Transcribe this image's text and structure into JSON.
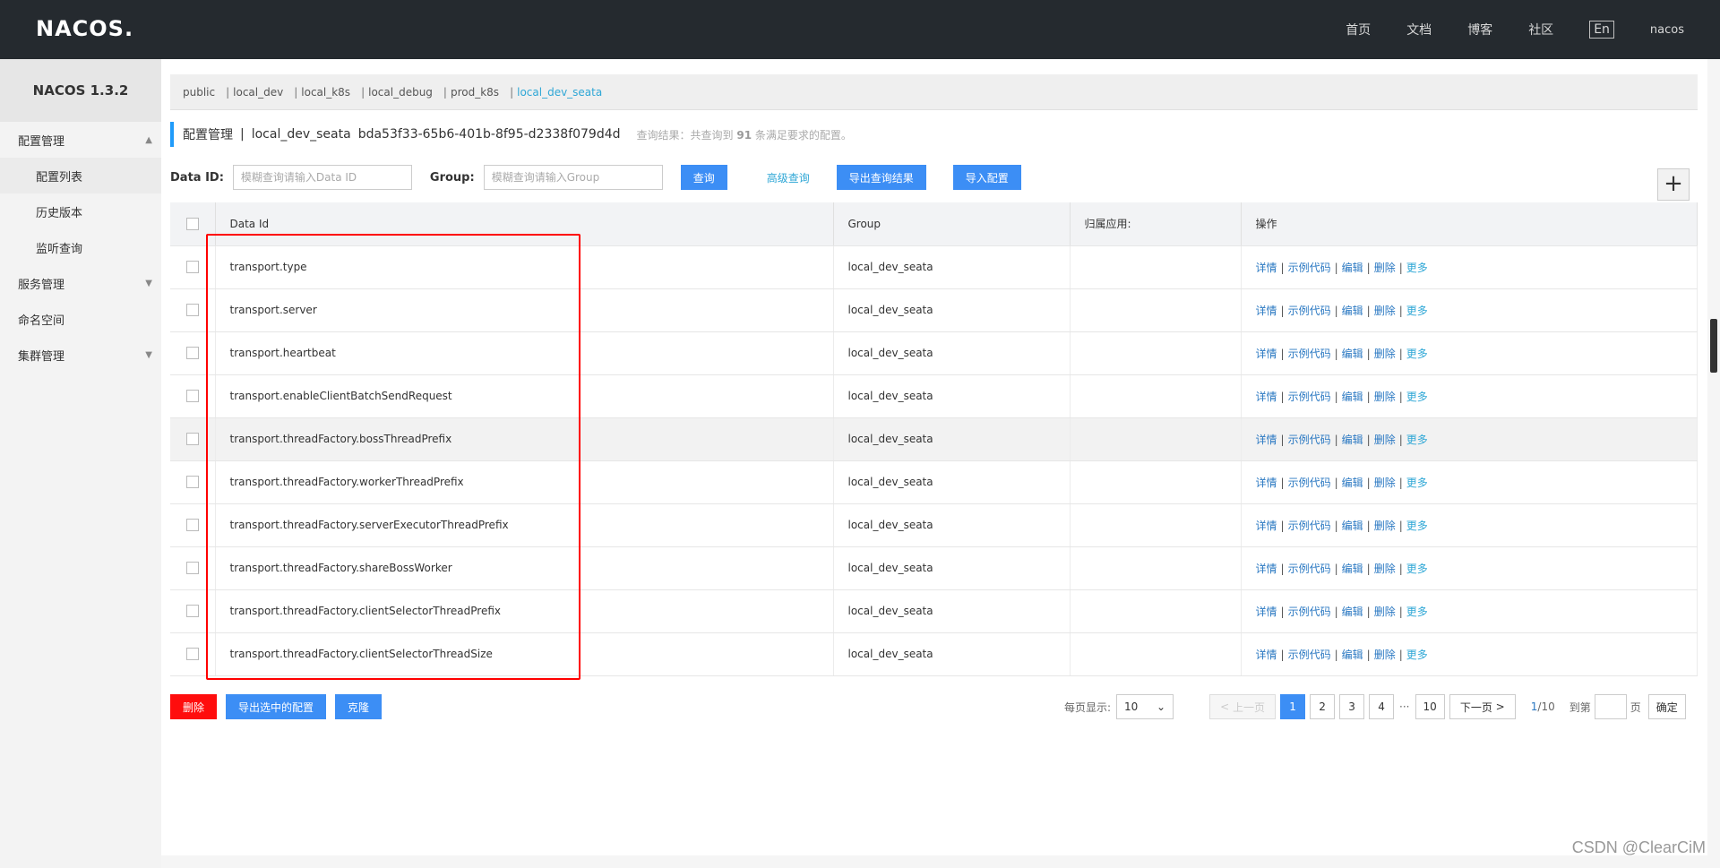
{
  "app": {
    "logo": "NACOS.",
    "nav": [
      "首页",
      "文档",
      "博客",
      "社区"
    ],
    "lang": "En",
    "user": "nacos"
  },
  "sidebar": {
    "brand": "NACOS 1.3.2",
    "groups": [
      {
        "label": "配置管理",
        "expanded": true,
        "items": [
          "配置列表",
          "历史版本",
          "监听查询"
        ]
      },
      {
        "label": "服务管理",
        "expanded": false
      },
      {
        "label": "命名空间"
      },
      {
        "label": "集群管理",
        "expanded": false
      }
    ]
  },
  "namespaces": [
    "public",
    "local_dev",
    "local_k8s",
    "local_debug",
    "prod_k8s",
    "local_dev_seata"
  ],
  "active_namespace": "local_dev_seata",
  "header": {
    "title": "配置管理",
    "namespace": "local_dev_seata",
    "namespace_id": "bda53f33-65b6-401b-8f95-d2338f079d4d",
    "result_prefix": "查询结果：共查询到",
    "result_count": "91",
    "result_suffix": "条满足要求的配置。"
  },
  "search": {
    "dataid_label": "Data ID:",
    "dataid_placeholder": "模糊查询请输入Data ID",
    "group_label": "Group:",
    "group_placeholder": "模糊查询请输入Group",
    "query": "查询",
    "advanced": "高级查询",
    "export_results": "导出查询结果",
    "import": "导入配置"
  },
  "table": {
    "headers": [
      "Data Id",
      "Group",
      "归属应用:",
      "操作"
    ],
    "rows": [
      {
        "data_id": "transport.type",
        "group": "local_dev_seata",
        "app": ""
      },
      {
        "data_id": "transport.server",
        "group": "local_dev_seata",
        "app": ""
      },
      {
        "data_id": "transport.heartbeat",
        "group": "local_dev_seata",
        "app": ""
      },
      {
        "data_id": "transport.enableClientBatchSendRequest",
        "group": "local_dev_seata",
        "app": ""
      },
      {
        "data_id": "transport.threadFactory.bossThreadPrefix",
        "group": "local_dev_seata",
        "app": ""
      },
      {
        "data_id": "transport.threadFactory.workerThreadPrefix",
        "group": "local_dev_seata",
        "app": ""
      },
      {
        "data_id": "transport.threadFactory.serverExecutorThreadPrefix",
        "group": "local_dev_seata",
        "app": ""
      },
      {
        "data_id": "transport.threadFactory.shareBossWorker",
        "group": "local_dev_seata",
        "app": ""
      },
      {
        "data_id": "transport.threadFactory.clientSelectorThreadPrefix",
        "group": "local_dev_seata",
        "app": ""
      },
      {
        "data_id": "transport.threadFactory.clientSelectorThreadSize",
        "group": "local_dev_seata",
        "app": ""
      }
    ],
    "ops": [
      "详情",
      "示例代码",
      "编辑",
      "删除",
      "更多"
    ]
  },
  "bottom": {
    "delete": "删除",
    "export_selected": "导出选中的配置",
    "clone": "克隆"
  },
  "pager": {
    "page_size_label": "每页显示:",
    "page_size": "10",
    "prev": "上一页",
    "pages": [
      "1",
      "2",
      "3",
      "4"
    ],
    "ellipsis": "···",
    "last": "10",
    "next": "下一页",
    "current": "1",
    "total": "/10",
    "goto_label": "到第",
    "page_unit": "页",
    "confirm": "确定"
  },
  "watermark": "CSDN @ClearCiM"
}
